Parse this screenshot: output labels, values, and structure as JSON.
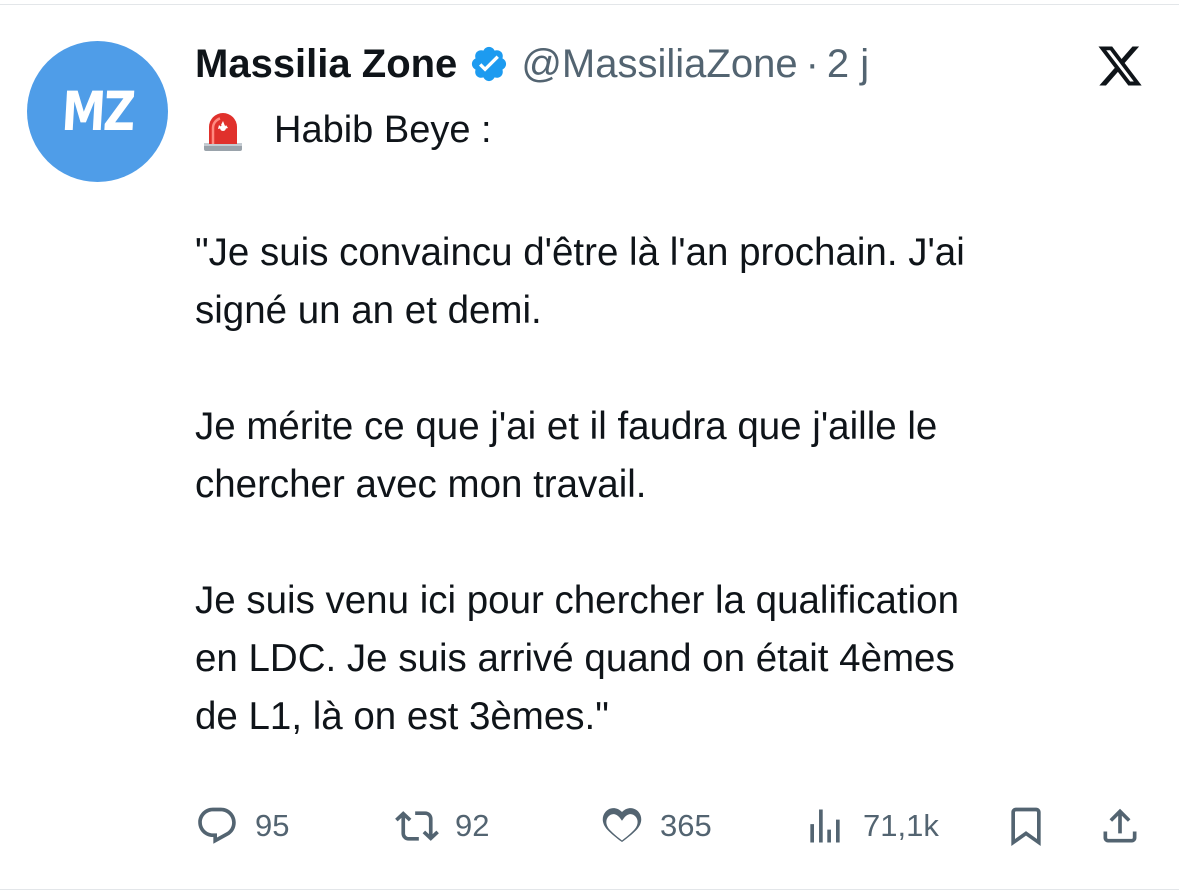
{
  "author": {
    "avatar_text": "MZ",
    "display_name": "Massilia Zone",
    "handle": "@MassiliaZone",
    "separator": "·",
    "time": "2 j"
  },
  "tweet": {
    "title": "Habib Beye :",
    "paragraphs": [
      "\"Je suis convaincu d'être là l'an prochain. J'ai\nsigné un an et demi.",
      "Je mérite ce que j'ai et il faudra que j'aille le\nchercher avec mon travail.",
      "Je suis venu ici pour chercher la qualification\nen LDC. Je suis arrivé quand on était 4èmes\nde L1, là on est 3èmes.\""
    ]
  },
  "actions": {
    "replies": "95",
    "retweets": "92",
    "likes": "365",
    "views": "71,1k"
  },
  "icons": {
    "verified": "verified-badge-icon",
    "x_logo": "x-logo-icon",
    "siren": "siren-emoji-icon",
    "reply": "reply-icon",
    "retweet": "retweet-icon",
    "like": "heart-icon",
    "views": "views-chart-icon",
    "bookmark": "bookmark-icon",
    "share": "share-icon"
  },
  "colors": {
    "avatar_bg": "#4f9de8",
    "verified": "#1d9bf0",
    "text_primary": "#0f1419",
    "text_secondary": "#536471",
    "siren_red": "#e0312c"
  }
}
